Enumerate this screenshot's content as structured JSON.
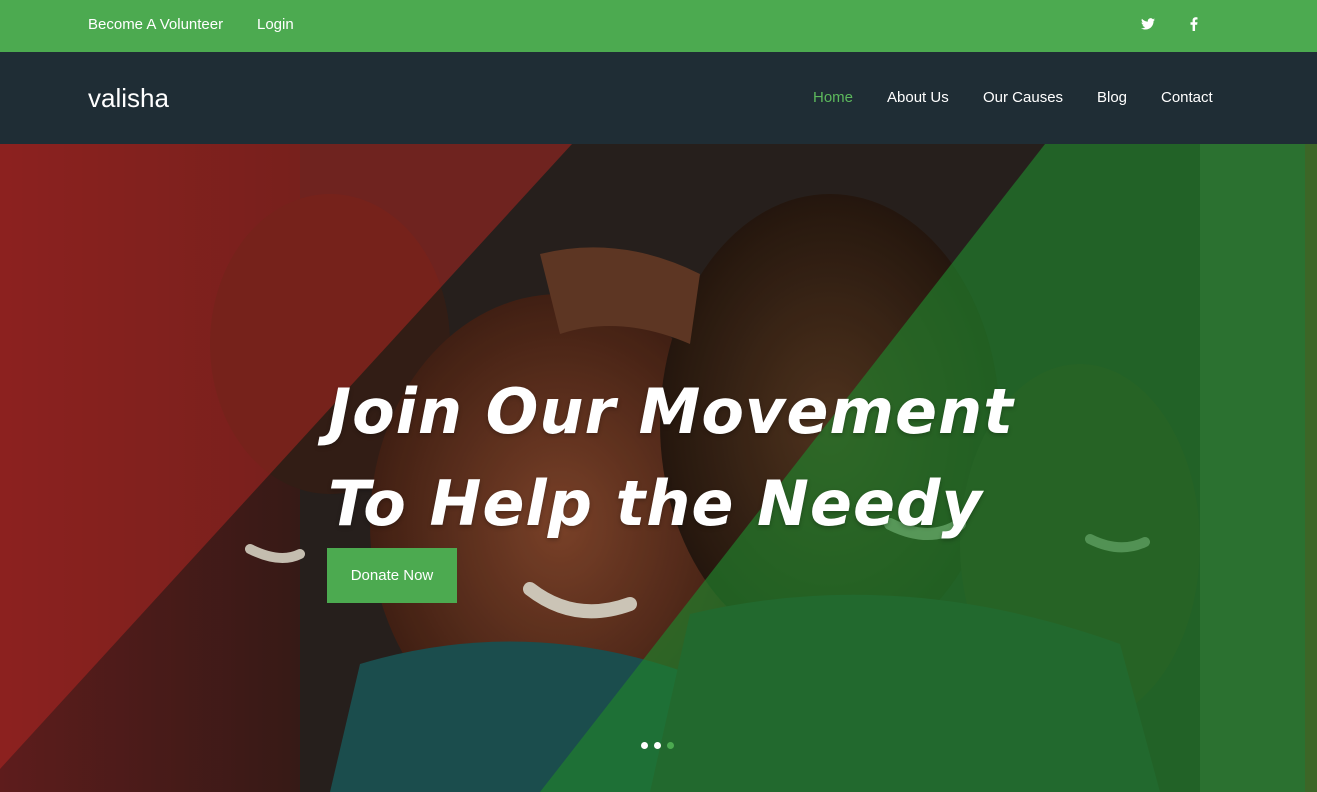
{
  "topbar": {
    "volunteer_label": "Become A Volunteer",
    "login_label": "Login",
    "social": [
      {
        "icon": "twitter-icon"
      },
      {
        "icon": "facebook-icon"
      }
    ]
  },
  "nav": {
    "brand": "valisha",
    "items": [
      {
        "label": "Home",
        "active": true
      },
      {
        "label": "About Us",
        "active": false
      },
      {
        "label": "Our Causes",
        "active": false
      },
      {
        "label": "Blog",
        "active": false
      },
      {
        "label": "Contact",
        "active": false
      }
    ]
  },
  "hero": {
    "headline_line1": "Join Our Movement",
    "headline_line2": "To Help the Needy",
    "cta_label": "Donate Now",
    "slides_total": 3,
    "active_slide": 3
  },
  "colors": {
    "accent_green": "#4caa50",
    "nav_dark": "#1f2d35",
    "active_link": "#5cb85c",
    "overlay_red": "#a8231f",
    "overlay_green": "#1e7a2a"
  }
}
